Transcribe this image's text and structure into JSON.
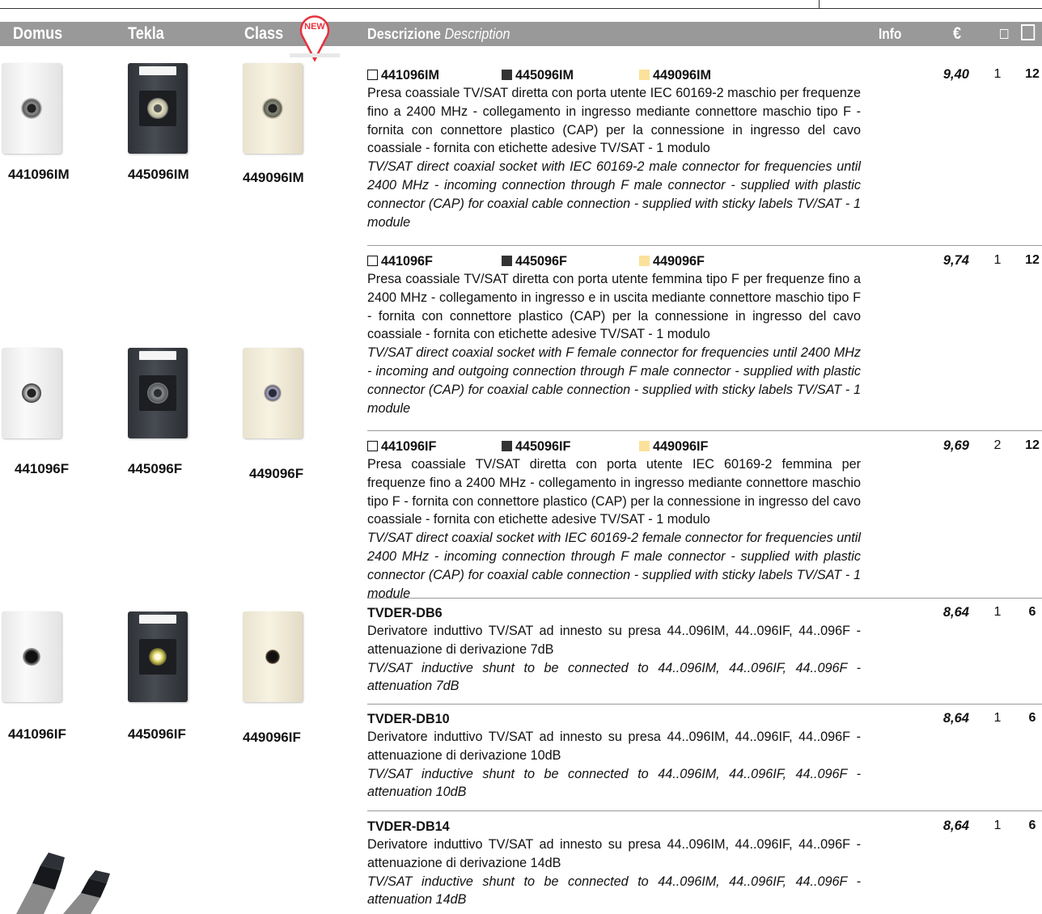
{
  "header": {
    "col_domus": "Domus",
    "col_tekla": "Tekla",
    "col_class": "Class",
    "new_badge": "NEW",
    "col_desc": "Descrizione",
    "col_desc_en": "Description",
    "col_info": "Info",
    "col_price": "€",
    "header_bg": "#999999"
  },
  "photos": [
    {
      "label": "441096IM",
      "finish": "white"
    },
    {
      "label": "445096IM",
      "finish": "dark"
    },
    {
      "label": "449096IM",
      "finish": "ivory"
    },
    {
      "label": "441096F",
      "finish": "white"
    },
    {
      "label": "445096F",
      "finish": "dark"
    },
    {
      "label": "449096F",
      "finish": "ivory"
    },
    {
      "label": "441096IF",
      "finish": "white"
    },
    {
      "label": "445096IF",
      "finish": "dark"
    },
    {
      "label": "449096IF",
      "finish": "ivory"
    }
  ],
  "entries": [
    {
      "codes": [
        "441096IM",
        "445096IM",
        "449096IM"
      ],
      "it": "Presa coassiale TV/SAT diretta con porta utente IEC 60169-2 maschio per frequenze fino a 2400 MHz - collegamento in ingresso mediante connettore maschio tipo F - fornita con connettore plastico (CAP) per la connessione in ingresso del cavo coassiale - fornita con etichette adesive TV/SAT - 1 modulo",
      "en": "TV/SAT direct coaxial socket with IEC 60169-2 male connector for frequencies until 2400 MHz - incoming connection through F male connector - supplied with plastic connector (CAP) for coaxial cable connection - supplied with sticky labels TV/SAT - 1 module",
      "price": "9,40",
      "q1": "1",
      "q2": "12"
    },
    {
      "codes": [
        "441096F",
        "445096F",
        "449096F"
      ],
      "it": "Presa coassiale TV/SAT diretta con porta utente femmina tipo F per frequenze fino a 2400 MHz - collegamento in ingresso e in uscita mediante connettore maschio tipo F - fornita con connettore plastico (CAP) per la connessione in ingresso del cavo coassiale - fornita con etichette adesive TV/SAT - 1 modulo",
      "en": "TV/SAT direct coaxial socket with F female connector for frequencies until 2400 MHz - incoming and outgoing connection through F male connector - supplied with plastic connector (CAP) for coaxial cable connection - supplied with sticky labels TV/SAT - 1 module",
      "price": "9,74",
      "q1": "1",
      "q2": "12"
    },
    {
      "codes": [
        "441096IF",
        "445096IF",
        "449096IF"
      ],
      "it": "Presa coassiale TV/SAT diretta con porta utente IEC 60169-2 femmina per frequenze fino a 2400 MHz - collegamento in ingresso mediante connettore maschio tipo F - fornita con connettore plastico (CAP) per la connessione in ingresso del cavo coassiale - fornita con etichette adesive TV/SAT - 1 modulo",
      "en": "TV/SAT direct coaxial socket with IEC 60169-2 female connector for frequencies until 2400 MHz - incoming connection through F male connector - supplied with plastic connector (CAP) for coaxial cable connection - supplied with sticky labels TV/SAT - 1 module",
      "price": "9,69",
      "q1": "2",
      "q2": "12"
    },
    {
      "code": "TVDER-DB6",
      "it": "Derivatore induttivo TV/SAT ad innesto su presa 44..096IM, 44..096IF, 44..096F - attenuazione di derivazione 7dB",
      "en": "TV/SAT inductive shunt to be connected to 44..096IM, 44..096IF, 44..096F - attenuation 7dB",
      "price": "8,64",
      "q1": "1",
      "q2": "6"
    },
    {
      "code": "TVDER-DB10",
      "it": "Derivatore induttivo TV/SAT ad innesto su presa 44..096IM, 44..096IF, 44..096F - attenuazione di derivazione 10dB",
      "en": "TV/SAT inductive shunt to be connected to 44..096IM, 44..096IF, 44..096F - attenuation 10dB",
      "price": "8,64",
      "q1": "1",
      "q2": "6"
    },
    {
      "code": "TVDER-DB14",
      "it": "Derivatore induttivo TV/SAT ad innesto su presa 44..096IM, 44..096IF, 44..096F - attenuazione di derivazione 14dB",
      "en": "TV/SAT inductive shunt to be connected to 44..096IM, 44..096IF, 44..096F - attenuation 14dB",
      "price": "8,64",
      "q1": "1",
      "q2": "6"
    }
  ],
  "colors": {
    "ivory_swatch": "#fbe19a",
    "dark_swatch": "#333333",
    "new_badge": "#e8303c"
  }
}
